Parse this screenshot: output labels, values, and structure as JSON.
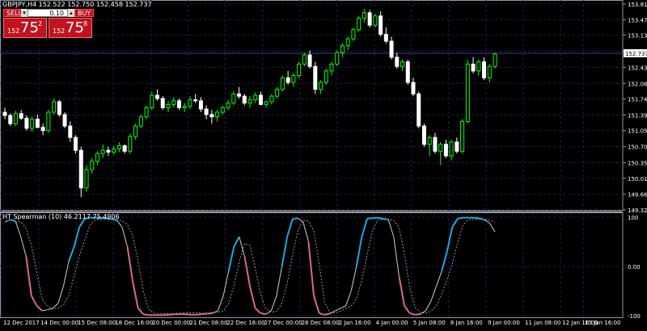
{
  "window": {
    "symbol_info": "GBPJPY,H4  152.522 152.750 152.458 152.737"
  },
  "trade_panel": {
    "sell_label": "SELL",
    "buy_label": "BUY",
    "lot_value": "0.10",
    "sell_price_small": "152",
    "sell_price_big": "75",
    "sell_price_sup": "2",
    "buy_price_small": "152",
    "buy_price_big": "75",
    "buy_price_sup": "8"
  },
  "colors": {
    "background": "#000000",
    "bull_candle": "#00ff00",
    "bear_candle": "#ffffff",
    "grid": "#1d1d5c",
    "current_price_line": "#3a3aa8",
    "indicator_up": "#1fa7e0",
    "indicator_down": "#d9688d",
    "indicator_neutral": "#cfcfcf",
    "signal_line": "#9a9a9a",
    "separator": "#9a9a9a"
  },
  "indicator": {
    "label": "HT Spearman (10) 46.2117 75.4906",
    "levels": [
      "100",
      "0.00",
      "-100"
    ]
  },
  "price_axis": {
    "ticks": [
      "153.810",
      "153.470",
      "153.130",
      "152.780",
      "152.430",
      "152.080",
      "151.740",
      "151.390",
      "151.050",
      "150.700",
      "150.350",
      "150.010",
      "149.660",
      "149.320"
    ],
    "current_price": "152.737"
  },
  "time_axis": {
    "ticks": [
      "12 Dec 2017",
      "14 Dec 00:00",
      "15 Dec 08:00",
      "18 Dec 16:00",
      "20 Dec 00:00",
      "21 Dec 08:00",
      "22 Dec 16:00",
      "27 Dec 00:00",
      "28 Dec 08:00",
      "2 Jan 16:00",
      "4 Jan 00:00",
      "5 Jan 08:00",
      "8 Jan 16:00",
      "9 Jan 00:00",
      "11 Jan 08:00",
      "12 Jan 16:00",
      "15 Jan 16:00"
    ]
  },
  "chart_data": {
    "type": "candlestick",
    "ylim": [
      149.32,
      153.81
    ],
    "candles": [
      [
        151.45,
        151.55,
        151.3,
        151.38
      ],
      [
        151.38,
        151.42,
        151.15,
        151.2
      ],
      [
        151.2,
        151.48,
        151.15,
        151.42
      ],
      [
        151.42,
        151.5,
        151.28,
        151.32
      ],
      [
        151.32,
        151.38,
        151.05,
        151.1
      ],
      [
        151.1,
        151.35,
        151.02,
        151.3
      ],
      [
        151.3,
        151.4,
        151.1,
        151.12
      ],
      [
        151.12,
        151.2,
        150.95,
        151.05
      ],
      [
        151.05,
        151.5,
        151.0,
        151.45
      ],
      [
        151.45,
        151.75,
        151.4,
        151.68
      ],
      [
        151.68,
        151.72,
        151.35,
        151.4
      ],
      [
        151.4,
        151.45,
        151.1,
        151.15
      ],
      [
        151.15,
        151.25,
        150.8,
        150.9
      ],
      [
        150.9,
        150.95,
        150.55,
        150.62
      ],
      [
        150.62,
        150.7,
        149.6,
        149.8
      ],
      [
        149.8,
        150.3,
        149.72,
        150.2
      ],
      [
        150.2,
        150.45,
        150.1,
        150.38
      ],
      [
        150.38,
        150.6,
        150.3,
        150.55
      ],
      [
        150.55,
        150.75,
        150.45,
        150.62
      ],
      [
        150.62,
        150.7,
        150.5,
        150.58
      ],
      [
        150.58,
        150.72,
        150.52,
        150.65
      ],
      [
        150.65,
        150.8,
        150.58,
        150.72
      ],
      [
        150.72,
        150.75,
        150.55,
        150.6
      ],
      [
        150.6,
        150.98,
        150.55,
        150.92
      ],
      [
        150.92,
        151.2,
        150.85,
        151.15
      ],
      [
        151.15,
        151.4,
        151.1,
        151.35
      ],
      [
        151.35,
        151.6,
        151.3,
        151.55
      ],
      [
        151.55,
        151.9,
        151.5,
        151.82
      ],
      [
        151.82,
        151.95,
        151.7,
        151.75
      ],
      [
        151.75,
        151.8,
        151.5,
        151.55
      ],
      [
        151.55,
        151.7,
        151.45,
        151.62
      ],
      [
        151.62,
        151.78,
        151.55,
        151.7
      ],
      [
        151.7,
        151.75,
        151.5,
        151.55
      ],
      [
        151.55,
        151.65,
        151.45,
        151.58
      ],
      [
        151.58,
        151.8,
        151.52,
        151.72
      ],
      [
        151.72,
        151.85,
        151.65,
        151.7
      ],
      [
        151.7,
        151.78,
        151.45,
        151.52
      ],
      [
        151.52,
        151.6,
        151.3,
        151.4
      ],
      [
        151.4,
        151.5,
        151.2,
        151.35
      ],
      [
        151.35,
        151.5,
        151.25,
        151.45
      ],
      [
        151.45,
        151.6,
        151.4,
        151.55
      ],
      [
        151.55,
        151.72,
        151.5,
        151.65
      ],
      [
        151.65,
        151.9,
        151.6,
        151.85
      ],
      [
        151.85,
        152.0,
        151.75,
        151.8
      ],
      [
        151.8,
        151.85,
        151.6,
        151.65
      ],
      [
        151.65,
        151.8,
        151.55,
        151.72
      ],
      [
        151.72,
        151.88,
        151.65,
        151.82
      ],
      [
        151.82,
        151.9,
        151.6,
        151.62
      ],
      [
        151.62,
        151.7,
        151.55,
        151.68
      ],
      [
        151.68,
        151.85,
        151.62,
        151.8
      ],
      [
        151.8,
        152.0,
        151.75,
        151.95
      ],
      [
        151.95,
        152.25,
        151.9,
        152.2
      ],
      [
        152.2,
        152.35,
        152.05,
        152.1
      ],
      [
        152.1,
        152.3,
        152.0,
        152.25
      ],
      [
        152.25,
        152.55,
        152.2,
        152.5
      ],
      [
        152.5,
        152.75,
        152.45,
        152.7
      ],
      [
        152.7,
        152.8,
        152.4,
        152.45
      ],
      [
        152.45,
        152.55,
        151.85,
        151.95
      ],
      [
        151.95,
        152.15,
        151.85,
        152.1
      ],
      [
        152.1,
        152.4,
        152.05,
        152.35
      ],
      [
        152.35,
        152.55,
        152.25,
        152.5
      ],
      [
        152.5,
        152.8,
        152.45,
        152.75
      ],
      [
        152.75,
        152.95,
        152.65,
        152.9
      ],
      [
        152.9,
        153.1,
        152.8,
        153.05
      ],
      [
        153.05,
        153.3,
        153.0,
        153.25
      ],
      [
        153.25,
        153.55,
        153.2,
        153.5
      ],
      [
        153.5,
        153.7,
        153.4,
        153.62
      ],
      [
        153.62,
        153.68,
        153.3,
        153.35
      ],
      [
        153.35,
        153.6,
        153.3,
        153.55
      ],
      [
        153.55,
        153.65,
        153.1,
        153.15
      ],
      [
        153.15,
        153.3,
        152.95,
        153.0
      ],
      [
        153.0,
        153.1,
        152.6,
        152.65
      ],
      [
        152.65,
        152.75,
        152.4,
        152.45
      ],
      [
        152.45,
        152.6,
        152.35,
        152.55
      ],
      [
        152.55,
        152.6,
        152.05,
        152.1
      ],
      [
        152.1,
        152.2,
        151.8,
        151.85
      ],
      [
        151.85,
        151.9,
        151.1,
        151.15
      ],
      [
        151.15,
        151.2,
        150.7,
        150.75
      ],
      [
        150.75,
        150.95,
        150.5,
        150.9
      ],
      [
        150.9,
        151.0,
        150.55,
        150.6
      ],
      [
        150.6,
        150.8,
        150.3,
        150.75
      ],
      [
        150.75,
        150.85,
        150.45,
        150.5
      ],
      [
        150.5,
        150.85,
        150.4,
        150.8
      ],
      [
        150.8,
        150.9,
        150.55,
        150.6
      ],
      [
        150.6,
        151.3,
        150.55,
        151.25
      ],
      [
        151.25,
        152.6,
        151.2,
        152.5
      ],
      [
        152.5,
        152.65,
        152.3,
        152.35
      ],
      [
        152.35,
        152.6,
        152.25,
        152.55
      ],
      [
        152.55,
        152.65,
        152.15,
        152.2
      ],
      [
        152.2,
        152.5,
        152.1,
        152.45
      ],
      [
        152.45,
        152.75,
        152.4,
        152.72
      ]
    ],
    "indicator_series": [
      90,
      95,
      92,
      60,
      20,
      -60,
      -80,
      -90,
      -88,
      -85,
      -75,
      -40,
      10,
      40,
      80,
      97,
      99,
      99,
      99,
      98,
      96,
      94,
      80,
      40,
      -30,
      -85,
      -97,
      -99,
      -99,
      -99,
      -99,
      -98,
      -97,
      -97,
      -97,
      -98,
      -98,
      -97,
      -96,
      -95,
      -90,
      -60,
      -10,
      40,
      60,
      20,
      -40,
      -85,
      -95,
      -97,
      -90,
      -60,
      0,
      60,
      96,
      98,
      90,
      50,
      -60,
      -95,
      -98,
      -96,
      -90,
      -85,
      -80,
      -50,
      0,
      60,
      97,
      98,
      99,
      97,
      95,
      60,
      -20,
      -80,
      -95,
      -98,
      -97,
      -90,
      -70,
      -40,
      -10,
      30,
      80,
      97,
      99,
      99,
      99,
      98,
      95,
      88,
      70
    ]
  }
}
